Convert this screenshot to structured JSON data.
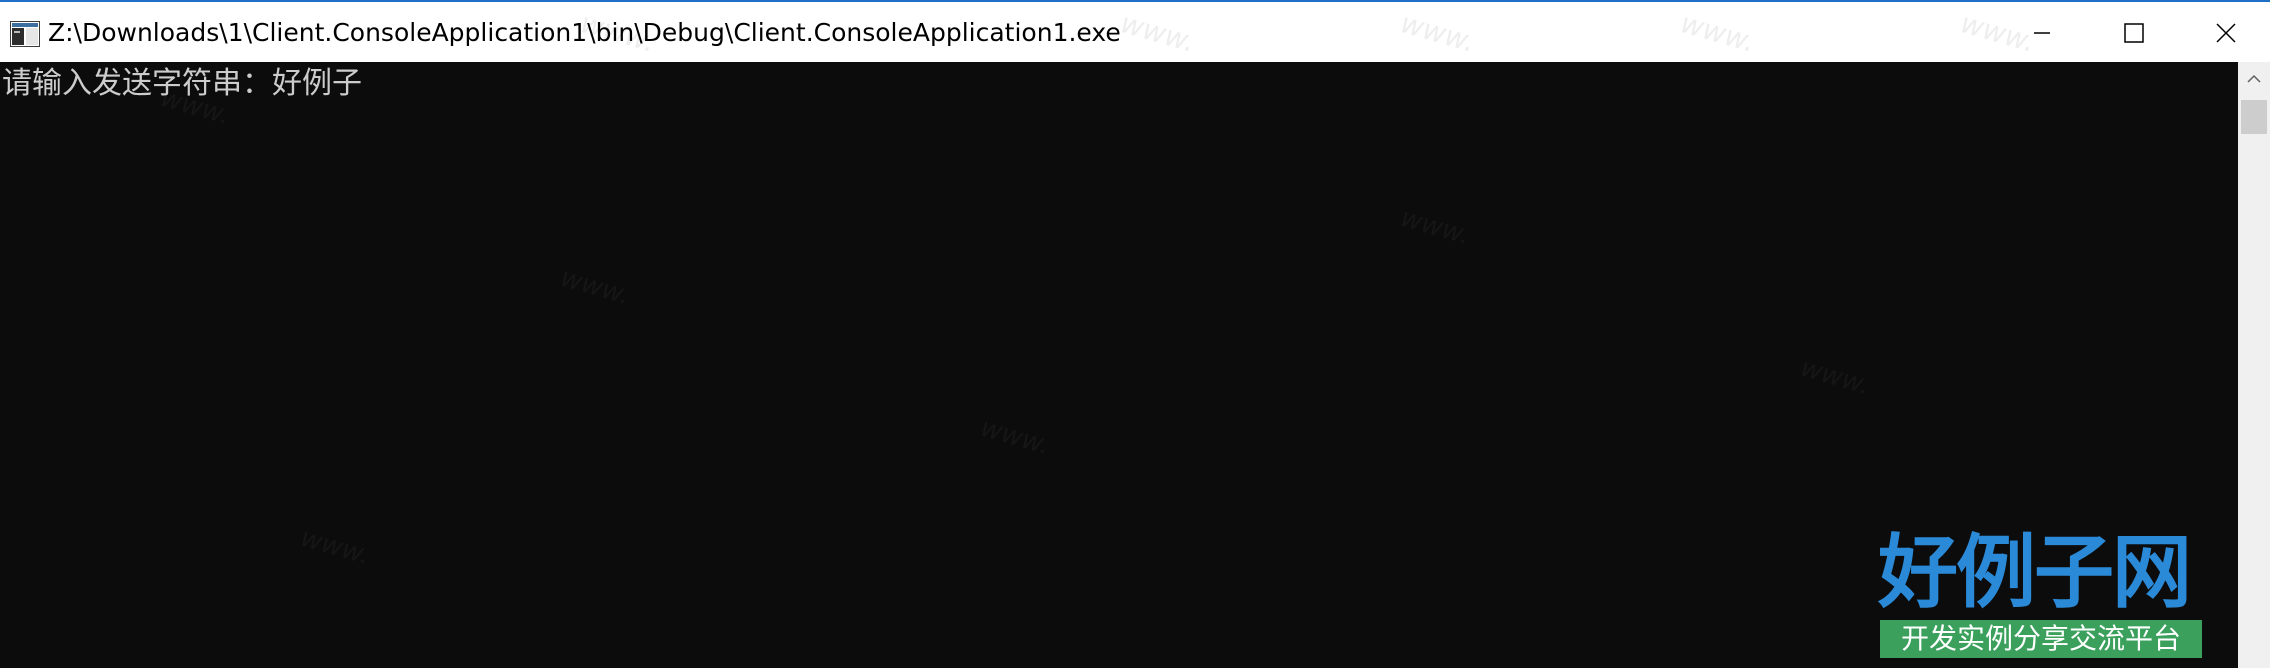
{
  "window": {
    "title": "Z:\\Downloads\\1\\Client.ConsoleApplication1\\bin\\Debug\\Client.ConsoleApplication1.exe",
    "app_icon": "console-app-icon",
    "controls": {
      "minimize_icon": "minimize-icon",
      "maximize_icon": "maximize-icon",
      "close_icon": "close-icon"
    }
  },
  "console": {
    "prompt": "请输入发送字符串：",
    "input": "好例子"
  },
  "watermark": {
    "text": "www.",
    "logo_title": "好例子网",
    "logo_subtitle": "开发实例分享交流平台"
  },
  "scrollbar": {
    "up_icon": "scroll-up-arrow-icon"
  },
  "colors": {
    "console_bg": "#0c0c0c",
    "console_text": "#cccccc",
    "logo_blue": "#2a8ad8",
    "logo_green": "#3aa05c"
  }
}
